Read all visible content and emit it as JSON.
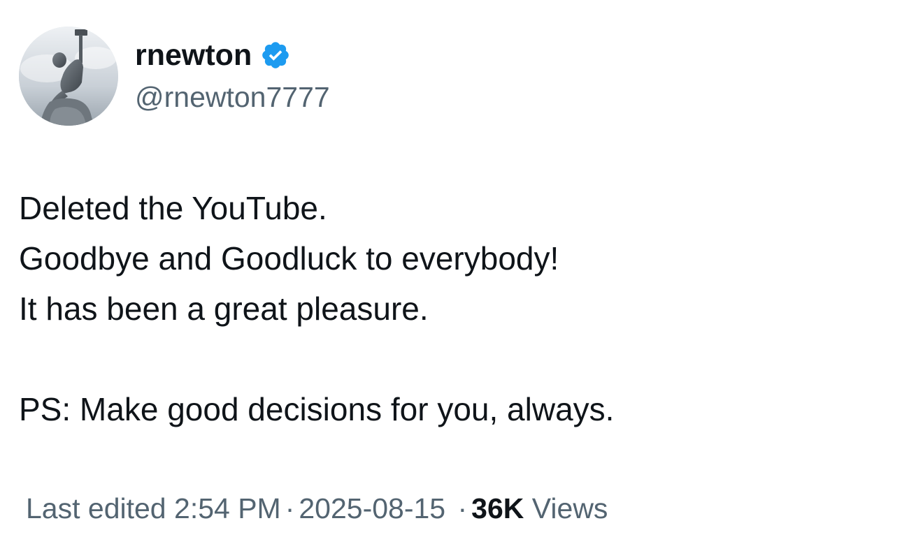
{
  "author": {
    "display_name": "rnewton",
    "handle": "@rnewton7777",
    "verified": true,
    "verified_color": "#1d9bf0"
  },
  "tweet": {
    "lines": [
      "Deleted the YouTube.",
      "Goodbye and Goodluck to everybody!",
      "It has been a great pleasure.",
      "",
      "PS: Make good decisions for you, always."
    ]
  },
  "meta": {
    "edited_label": "Last edited",
    "time": "2:54 PM",
    "separator": "·",
    "date": "2025-08-15",
    "views_count": "36K",
    "views_label": "Views"
  },
  "icons": {
    "avatar": "statue-avatar",
    "verified": "verified-badge-icon"
  }
}
